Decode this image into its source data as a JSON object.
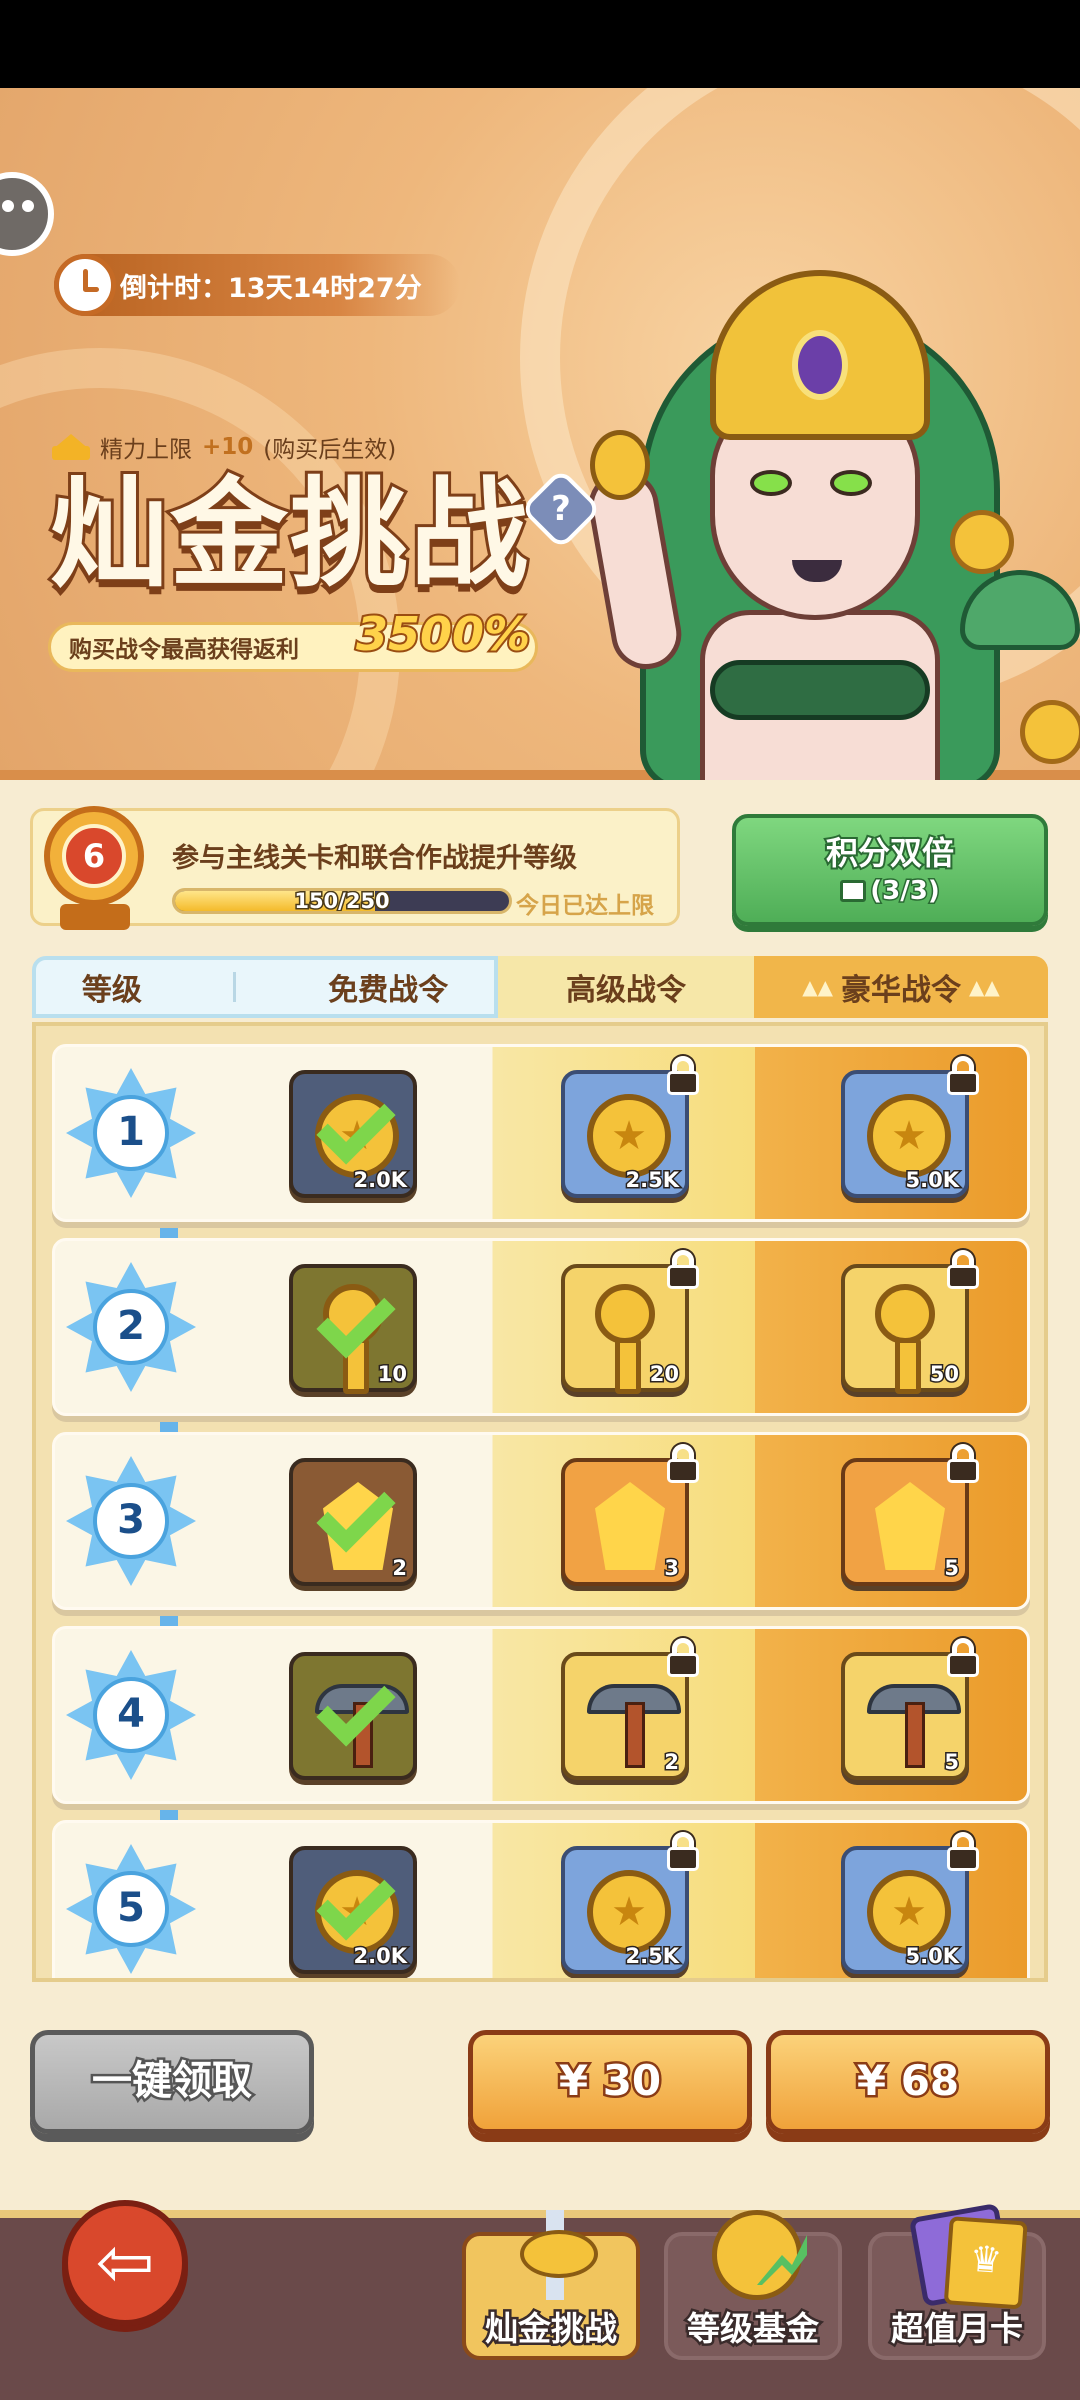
{
  "banner": {
    "countdown": "倒计时：13天14时27分",
    "stamina_label": "精力上限",
    "stamina_bonus": "+10",
    "stamina_note": "(购买后生效)",
    "title": "灿金挑战",
    "help_symbol": "?",
    "rebate_label": "购买战令最高获得返利",
    "rebate_pct": "3500%"
  },
  "level": {
    "value": "6",
    "description": "参与主线关卡和联合作战提升等级",
    "progress_text": "150/250",
    "progress_fraction": 0.6,
    "limit_text": "今日已达上限"
  },
  "double_points": {
    "title": "积分双倍",
    "count": "(3/3)"
  },
  "tabs": {
    "level": "等级",
    "free": "免费战令",
    "advanced": "高级战令",
    "luxury": "豪华战令",
    "deco": "▲▲"
  },
  "rows": [
    {
      "level": "1",
      "free": {
        "icon": "coin-icon",
        "count": "2.0K"
      },
      "adv": {
        "icon": "coin-icon",
        "count": "2.5K"
      },
      "lux": {
        "icon": "coin-icon",
        "count": "5.0K"
      }
    },
    {
      "level": "2",
      "free": {
        "icon": "key-icon",
        "count": "10"
      },
      "adv": {
        "icon": "key-icon",
        "count": "20"
      },
      "lux": {
        "icon": "key-icon",
        "count": "50"
      }
    },
    {
      "level": "3",
      "free": {
        "icon": "crystal-icon",
        "count": "2"
      },
      "adv": {
        "icon": "crystal-icon",
        "count": "3"
      },
      "lux": {
        "icon": "crystal-icon",
        "count": "5"
      }
    },
    {
      "level": "4",
      "free": {
        "icon": "pickaxe-icon",
        "count": ""
      },
      "adv": {
        "icon": "pickaxe-icon",
        "count": "2"
      },
      "lux": {
        "icon": "pickaxe-icon",
        "count": "5"
      }
    },
    {
      "level": "5",
      "free": {
        "icon": "coin-icon",
        "count": "2.0K"
      },
      "adv": {
        "icon": "coin-icon",
        "count": "2.5K"
      },
      "lux": {
        "icon": "coin-icon",
        "count": "5.0K"
      }
    }
  ],
  "buttons": {
    "claim_all": "一键领取",
    "price_advanced": "¥ 30",
    "price_luxury": "¥ 68"
  },
  "nav": {
    "items": [
      "灿金挑战",
      "等级基金",
      "超值月卡"
    ]
  }
}
